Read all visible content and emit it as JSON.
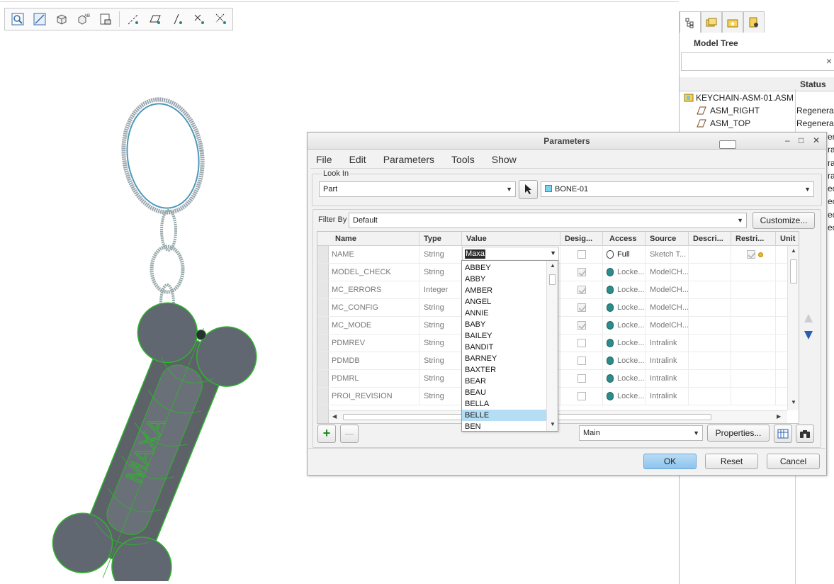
{
  "toolbar": {
    "icons": [
      "zoom-fit-icon",
      "refit-view-icon",
      "view-orient-icon",
      "named-views-icon",
      "saved-views-icon",
      "datum-axis-display-icon",
      "datum-plane-display-icon",
      "datum-point-display-icon",
      "csys-display-icon",
      "annotation-display-icon"
    ]
  },
  "model_tree": {
    "title": "Model Tree",
    "clear_label": "×",
    "status_header": "Status",
    "rows": [
      {
        "label": "KEYCHAIN-ASM-01.ASM",
        "status": ""
      },
      {
        "label": "ASM_RIGHT",
        "status": "Regenera"
      },
      {
        "label": "ASM_TOP",
        "status": "Regenera"
      }
    ],
    "status_fragments": [
      "era",
      "ra",
      "ra",
      "ra",
      "ec",
      "ec",
      "ec",
      "ec"
    ]
  },
  "dialog": {
    "title": "Parameters",
    "minimize": "–",
    "maximize": "□",
    "close": "✕",
    "menus": [
      "File",
      "Edit",
      "Parameters",
      "Tools",
      "Show"
    ],
    "look_in": {
      "label": "Look In",
      "type_value": "Part",
      "object_value": "BONE-01"
    },
    "filter": {
      "label": "Filter By",
      "value": "Default",
      "customize": "Customize..."
    },
    "columns": [
      "Name",
      "Type",
      "Value",
      "Desig...",
      "Access",
      "Source",
      "Descri...",
      "Restri...",
      "Unit"
    ],
    "rows": [
      {
        "name": "NAME",
        "type": "String",
        "value": "Maxa",
        "designated": false,
        "access": "Full",
        "source": "Sketch T..."
      },
      {
        "name": "MODEL_CHECK",
        "type": "String",
        "value": "",
        "designated": true,
        "access": "Locke...",
        "source": "ModelCH..."
      },
      {
        "name": "MC_ERRORS",
        "type": "Integer",
        "value": "",
        "designated": true,
        "access": "Locke...",
        "source": "ModelCH..."
      },
      {
        "name": "MC_CONFIG",
        "type": "String",
        "value": "",
        "designated": true,
        "access": "Locke...",
        "source": "ModelCH..."
      },
      {
        "name": "MC_MODE",
        "type": "String",
        "value": "",
        "designated": true,
        "access": "Locke...",
        "source": "ModelCH..."
      },
      {
        "name": "PDMREV",
        "type": "String",
        "value": "",
        "designated": false,
        "access": "Locke...",
        "source": "Intralink"
      },
      {
        "name": "PDMDB",
        "type": "String",
        "value": "",
        "designated": false,
        "access": "Locke...",
        "source": "Intralink"
      },
      {
        "name": "PDMRL",
        "type": "String",
        "value": "",
        "designated": false,
        "access": "Locke...",
        "source": "Intralink"
      },
      {
        "name": "PROI_REVISION",
        "type": "String",
        "value": "",
        "designated": false,
        "access": "Locke...",
        "source": "Intralink"
      }
    ],
    "value_dropdown": {
      "items": [
        "ABBEY",
        "ABBY",
        "AMBER",
        "ANGEL",
        "ANNIE",
        "BABY",
        "BAILEY",
        "BANDIT",
        "BARNEY",
        "BAXTER",
        "BEAR",
        "BEAU",
        "BELLA",
        "BELLE",
        "BEN"
      ],
      "selected": "BELLE"
    },
    "bottom": {
      "add": "+",
      "remove": "—",
      "set_value": "Main",
      "properties": "Properties..."
    },
    "buttons": {
      "ok": "OK",
      "reset": "Reset",
      "cancel": "Cancel"
    }
  },
  "colors": {
    "selected_item": "#b5def5",
    "ok_button": "#8cc4ee",
    "model_wire": "#2db52d",
    "model_body": "#5c6268"
  }
}
